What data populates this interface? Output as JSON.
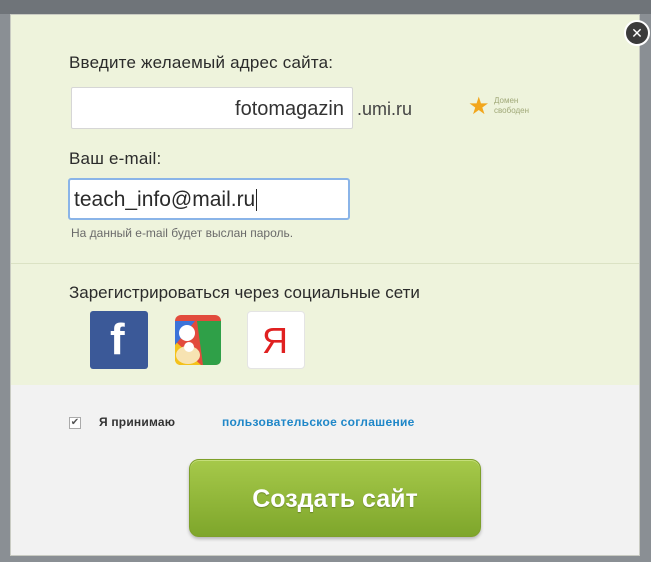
{
  "modal": {
    "domain_label": "Введите желаемый адрес сайта:",
    "domain_value": "fotomagazin",
    "domain_suffix": ".umi.ru",
    "domain_status": "Домен свободен",
    "email_label": "Ваш e-mail:",
    "email_value": "teach_info@mail.ru",
    "email_hint": "На данный e-mail будет выслан пароль.",
    "social_title": "Зарегистрироваться через социальные сети",
    "social": [
      {
        "name": "facebook",
        "glyph": "f"
      },
      {
        "name": "google",
        "glyph": ""
      },
      {
        "name": "yandex",
        "glyph": "Я"
      }
    ],
    "accept_text": "Я принимаю",
    "agreement_link": "пользовательское соглашение",
    "accept_checked": true,
    "create_button": "Создать сайт",
    "close_glyph": "✕"
  },
  "colors": {
    "panel_green": "#eef3dc",
    "button_green": "#8cb53a",
    "link_blue": "#1f87c8",
    "facebook_blue": "#3b5998",
    "yandex_red": "#e02020"
  }
}
